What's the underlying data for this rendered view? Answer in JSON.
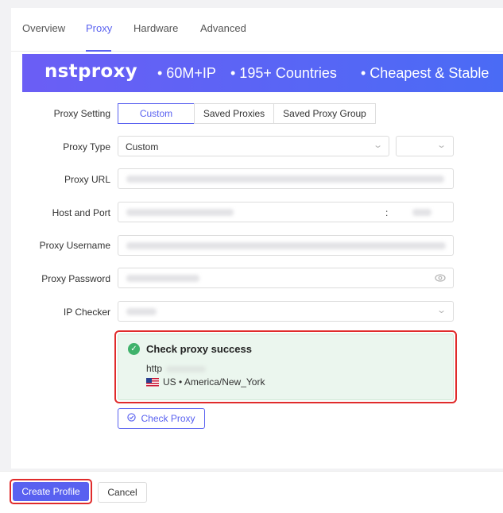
{
  "tabs": [
    {
      "label": "Overview"
    },
    {
      "label": "Proxy",
      "active": true
    },
    {
      "label": "Hardware"
    },
    {
      "label": "Advanced"
    }
  ],
  "banner": {
    "logo": "nstproxy",
    "points": [
      "• 60M+IP",
      "• 195+ Countries",
      "• Cheapest & Stable"
    ]
  },
  "form": {
    "proxy_setting": {
      "label": "Proxy Setting",
      "options": [
        "Custom",
        "Saved Proxies",
        "Saved Proxy Group"
      ],
      "selected": "Custom"
    },
    "proxy_type": {
      "label": "Proxy Type",
      "value": "Custom"
    },
    "proxy_url": {
      "label": "Proxy URL"
    },
    "host_port": {
      "label": "Host and Port",
      "separator": ":"
    },
    "proxy_username": {
      "label": "Proxy Username"
    },
    "proxy_password": {
      "label": "Proxy Password"
    },
    "ip_checker": {
      "label": "IP Checker"
    }
  },
  "check_result": {
    "title": "Check proxy success",
    "protocol": "http",
    "location": "US • America/New_York"
  },
  "buttons": {
    "check_proxy": "Check Proxy",
    "create_profile": "Create Profile",
    "cancel": "Cancel"
  },
  "icons": {
    "success": "check-circle-icon",
    "check_proxy": "check-circle-outline-icon",
    "password_toggle": "eye-icon",
    "dropdown": "chevron-down-icon"
  },
  "colors": {
    "accent": "#5961f0",
    "success": "#3fb26b",
    "highlight": "#e02b2b"
  }
}
